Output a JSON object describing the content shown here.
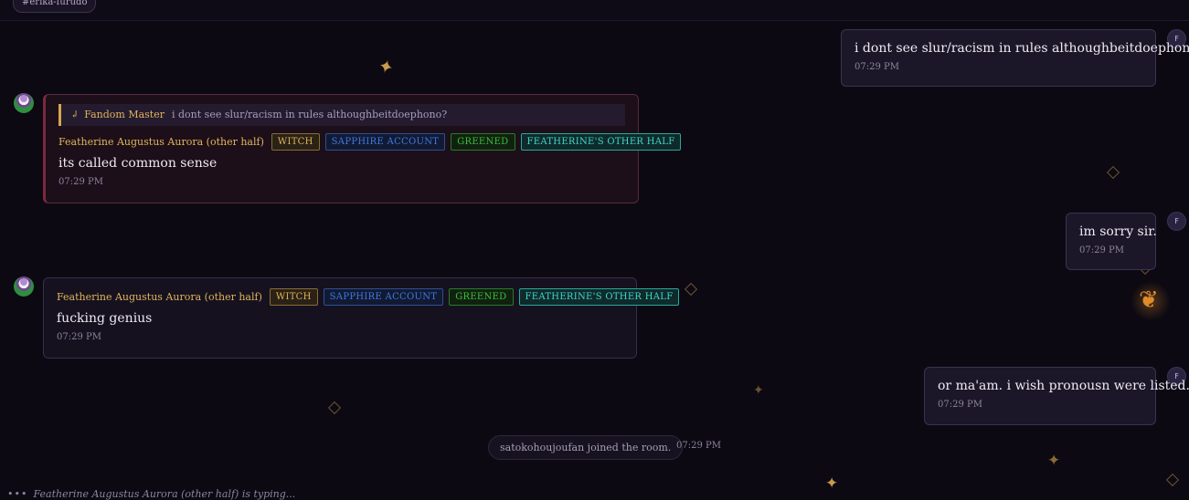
{
  "channel": {
    "tag": "#erika-furudo"
  },
  "messages": {
    "m1": {
      "text": "i dont see slur/racism in rules althoughbeitdoephono?",
      "time": "07:29 PM",
      "avatar": "F"
    },
    "m2": {
      "quote_author": "Fandom Master",
      "quote_text": "i dont see slur/racism in rules althoughbeitdoephono?",
      "author": "Featherine Augustus Aurora (other half)",
      "badges": [
        "WITCH",
        "SAPPHIRE ACCOUNT",
        "GREENED",
        "FEATHERINE'S OTHER HALF"
      ],
      "text": "its called common sense",
      "time": "07:29 PM"
    },
    "m3": {
      "text": "im sorry sir.",
      "time": "07:29 PM",
      "avatar": "F"
    },
    "m4": {
      "author": "Featherine Augustus Aurora (other half)",
      "badges": [
        "WITCH",
        "SAPPHIRE ACCOUNT",
        "GREENED",
        "FEATHERINE'S OTHER HALF"
      ],
      "text": "fucking genius",
      "time": "07:29 PM"
    },
    "m5": {
      "text": "or ma'am. i wish pronousn were listed.",
      "time": "07:29 PM",
      "avatar": "F"
    }
  },
  "system": {
    "joined_text": "satokohoujoufan joined the room.",
    "time": "07:29 PM"
  },
  "typing": {
    "dots": "•••",
    "text": "Featherine Augustus Aurora (other half) is typing..."
  },
  "icons": {
    "reply": "reply-arrow-icon",
    "sparkle": "four-point-star-icon",
    "butterfly": "butterfly-icon",
    "diamond": "diamond-outline-icon"
  },
  "colors": {
    "background": "#0c0912",
    "author": "#e2b45a",
    "witch": "#e0b35a",
    "sapphire": "#3e7ae0",
    "greened": "#3cbf3c",
    "other_half": "#3fd8d0"
  }
}
